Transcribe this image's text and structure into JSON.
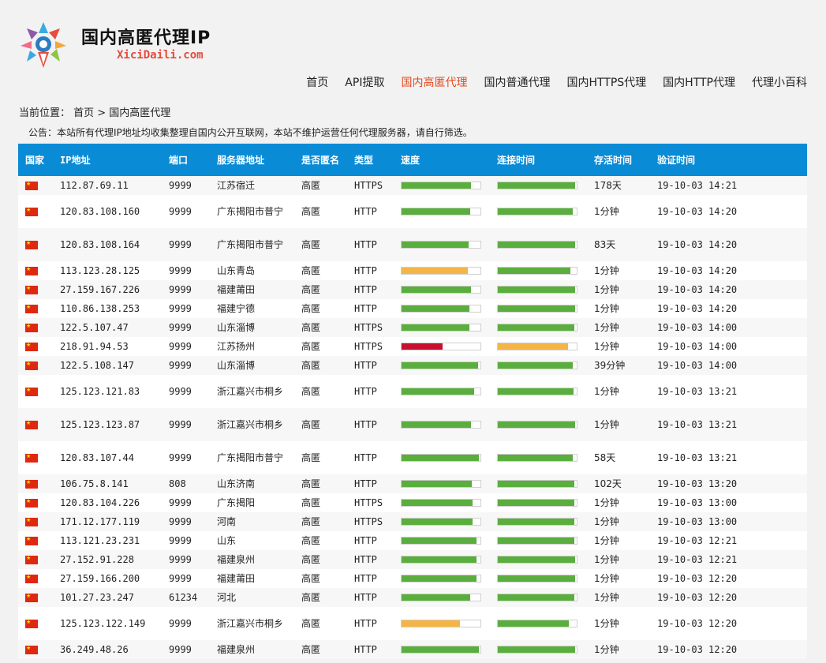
{
  "site": {
    "title": "国内高匿代理IP",
    "domain": "XiciDaili.com"
  },
  "nav": [
    {
      "label": "首页",
      "mono": false,
      "active": false
    },
    {
      "label": "API提取",
      "mono": false,
      "active": false
    },
    {
      "label": "国内高匿代理",
      "mono": false,
      "active": true
    },
    {
      "label": "国内普通代理",
      "mono": false,
      "active": false
    },
    {
      "label": "国内HTTPS代理",
      "mono": false,
      "active": false
    },
    {
      "label": "国内HTTP代理",
      "mono": false,
      "active": false
    },
    {
      "label": "代理小百科",
      "mono": false,
      "active": false
    }
  ],
  "breadcrumb": "当前位置： 首页 > 国内高匿代理",
  "notice": "公告：本站所有代理IP地址均收集整理自国内公开互联网，本站不维护运营任何代理服务器，请自行筛选。",
  "colors": {
    "header_bg": "#0a8bd6",
    "green": "#5aae3d",
    "orange": "#f5b544",
    "red": "#c8102e",
    "active_nav": "#e24a1f"
  },
  "table": {
    "headers": [
      "国家",
      "IP地址",
      "端口",
      "服务器地址",
      "是否匿名",
      "类型",
      "速度",
      "连接时间",
      "存活时间",
      "验证时间"
    ],
    "rows": [
      {
        "country_icon": "cn-flag-icon",
        "ip": "112.87.69.11",
        "port": "9999",
        "location": "江苏宿迁",
        "anon": "高匿",
        "type": "HTTPS",
        "speed": 0.88,
        "speed_color": "green",
        "connect": 0.98,
        "connect_color": "green",
        "alive": "178天",
        "verified": "19-10-03 14:21"
      },
      {
        "country_icon": "cn-flag-icon",
        "ip": "120.83.108.160",
        "port": "9999",
        "location": "广东揭阳市普宁",
        "anon": "高匿",
        "type": "HTTP",
        "speed": 0.87,
        "speed_color": "green",
        "connect": 0.95,
        "connect_color": "green",
        "alive": "1分钟",
        "verified": "19-10-03 14:20"
      },
      {
        "country_icon": "cn-flag-icon",
        "ip": "120.83.108.164",
        "port": "9999",
        "location": "广东揭阳市普宁",
        "anon": "高匿",
        "type": "HTTP",
        "speed": 0.85,
        "speed_color": "green",
        "connect": 0.98,
        "connect_color": "green",
        "alive": "83天",
        "verified": "19-10-03 14:20"
      },
      {
        "country_icon": "cn-flag-icon",
        "ip": "113.123.28.125",
        "port": "9999",
        "location": "山东青岛",
        "anon": "高匿",
        "type": "HTTP",
        "speed": 0.84,
        "speed_color": "orange",
        "connect": 0.92,
        "connect_color": "green",
        "alive": "1分钟",
        "verified": "19-10-03 14:20"
      },
      {
        "country_icon": "cn-flag-icon",
        "ip": "27.159.167.226",
        "port": "9999",
        "location": "福建莆田",
        "anon": "高匿",
        "type": "HTTP",
        "speed": 0.88,
        "speed_color": "green",
        "connect": 0.98,
        "connect_color": "green",
        "alive": "1分钟",
        "verified": "19-10-03 14:20"
      },
      {
        "country_icon": "cn-flag-icon",
        "ip": "110.86.138.253",
        "port": "9999",
        "location": "福建宁德",
        "anon": "高匿",
        "type": "HTTP",
        "speed": 0.86,
        "speed_color": "green",
        "connect": 0.98,
        "connect_color": "green",
        "alive": "1分钟",
        "verified": "19-10-03 14:20"
      },
      {
        "country_icon": "cn-flag-icon",
        "ip": "122.5.107.47",
        "port": "9999",
        "location": "山东淄博",
        "anon": "高匿",
        "type": "HTTPS",
        "speed": 0.86,
        "speed_color": "green",
        "connect": 0.97,
        "connect_color": "green",
        "alive": "1分钟",
        "verified": "19-10-03 14:00"
      },
      {
        "country_icon": "cn-flag-icon",
        "ip": "218.91.94.53",
        "port": "9999",
        "location": "江苏扬州",
        "anon": "高匿",
        "type": "HTTPS",
        "speed": 0.52,
        "speed_color": "red",
        "connect": 0.89,
        "connect_color": "orange",
        "alive": "1分钟",
        "verified": "19-10-03 14:00"
      },
      {
        "country_icon": "cn-flag-icon",
        "ip": "122.5.108.147",
        "port": "9999",
        "location": "山东淄博",
        "anon": "高匿",
        "type": "HTTP",
        "speed": 0.97,
        "speed_color": "green",
        "connect": 0.95,
        "connect_color": "green",
        "alive": "39分钟",
        "verified": "19-10-03 14:00"
      },
      {
        "country_icon": "cn-flag-icon",
        "ip": "125.123.121.83",
        "port": "9999",
        "location": "浙江嘉兴市桐乡",
        "anon": "高匿",
        "type": "HTTP",
        "speed": 0.92,
        "speed_color": "green",
        "connect": 0.96,
        "connect_color": "green",
        "alive": "1分钟",
        "verified": "19-10-03 13:21"
      },
      {
        "country_icon": "cn-flag-icon",
        "ip": "125.123.123.87",
        "port": "9999",
        "location": "浙江嘉兴市桐乡",
        "anon": "高匿",
        "type": "HTTP",
        "speed": 0.88,
        "speed_color": "green",
        "connect": 0.98,
        "connect_color": "green",
        "alive": "1分钟",
        "verified": "19-10-03 13:21"
      },
      {
        "country_icon": "cn-flag-icon",
        "ip": "120.83.107.44",
        "port": "9999",
        "location": "广东揭阳市普宁",
        "anon": "高匿",
        "type": "HTTP",
        "speed": 0.98,
        "speed_color": "green",
        "connect": 0.95,
        "connect_color": "green",
        "alive": "58天",
        "verified": "19-10-03 13:21"
      },
      {
        "country_icon": "cn-flag-icon",
        "ip": "106.75.8.141",
        "port": "808",
        "location": "山东济南",
        "anon": "高匿",
        "type": "HTTP",
        "speed": 0.89,
        "speed_color": "green",
        "connect": 0.97,
        "connect_color": "green",
        "alive": "102天",
        "verified": "19-10-03 13:20"
      },
      {
        "country_icon": "cn-flag-icon",
        "ip": "120.83.104.226",
        "port": "9999",
        "location": "广东揭阳",
        "anon": "高匿",
        "type": "HTTPS",
        "speed": 0.9,
        "speed_color": "green",
        "connect": 0.97,
        "connect_color": "green",
        "alive": "1分钟",
        "verified": "19-10-03 13:00"
      },
      {
        "country_icon": "cn-flag-icon",
        "ip": "171.12.177.119",
        "port": "9999",
        "location": "河南",
        "anon": "高匿",
        "type": "HTTPS",
        "speed": 0.9,
        "speed_color": "green",
        "connect": 0.97,
        "connect_color": "green",
        "alive": "1分钟",
        "verified": "19-10-03 13:00"
      },
      {
        "country_icon": "cn-flag-icon",
        "ip": "113.121.23.231",
        "port": "9999",
        "location": "山东",
        "anon": "高匿",
        "type": "HTTP",
        "speed": 0.95,
        "speed_color": "green",
        "connect": 0.97,
        "connect_color": "green",
        "alive": "1分钟",
        "verified": "19-10-03 12:21"
      },
      {
        "country_icon": "cn-flag-icon",
        "ip": "27.152.91.228",
        "port": "9999",
        "location": "福建泉州",
        "anon": "高匿",
        "type": "HTTP",
        "speed": 0.95,
        "speed_color": "green",
        "connect": 0.98,
        "connect_color": "green",
        "alive": "1分钟",
        "verified": "19-10-03 12:21"
      },
      {
        "country_icon": "cn-flag-icon",
        "ip": "27.159.166.200",
        "port": "9999",
        "location": "福建莆田",
        "anon": "高匿",
        "type": "HTTP",
        "speed": 0.95,
        "speed_color": "green",
        "connect": 0.98,
        "connect_color": "green",
        "alive": "1分钟",
        "verified": "19-10-03 12:20"
      },
      {
        "country_icon": "cn-flag-icon",
        "ip": "101.27.23.247",
        "port": "61234",
        "location": "河北",
        "anon": "高匿",
        "type": "HTTP",
        "speed": 0.87,
        "speed_color": "green",
        "connect": 0.97,
        "connect_color": "green",
        "alive": "1分钟",
        "verified": "19-10-03 12:20"
      },
      {
        "country_icon": "cn-flag-icon",
        "ip": "125.123.122.149",
        "port": "9999",
        "location": "浙江嘉兴市桐乡",
        "anon": "高匿",
        "type": "HTTP",
        "speed": 0.74,
        "speed_color": "orange",
        "connect": 0.9,
        "connect_color": "green",
        "alive": "1分钟",
        "verified": "19-10-03 12:20"
      },
      {
        "country_icon": "cn-flag-icon",
        "ip": "36.249.48.26",
        "port": "9999",
        "location": "福建泉州",
        "anon": "高匿",
        "type": "HTTP",
        "speed": 0.98,
        "speed_color": "green",
        "connect": 0.98,
        "connect_color": "green",
        "alive": "1分钟",
        "verified": "19-10-03 12:20"
      }
    ]
  }
}
